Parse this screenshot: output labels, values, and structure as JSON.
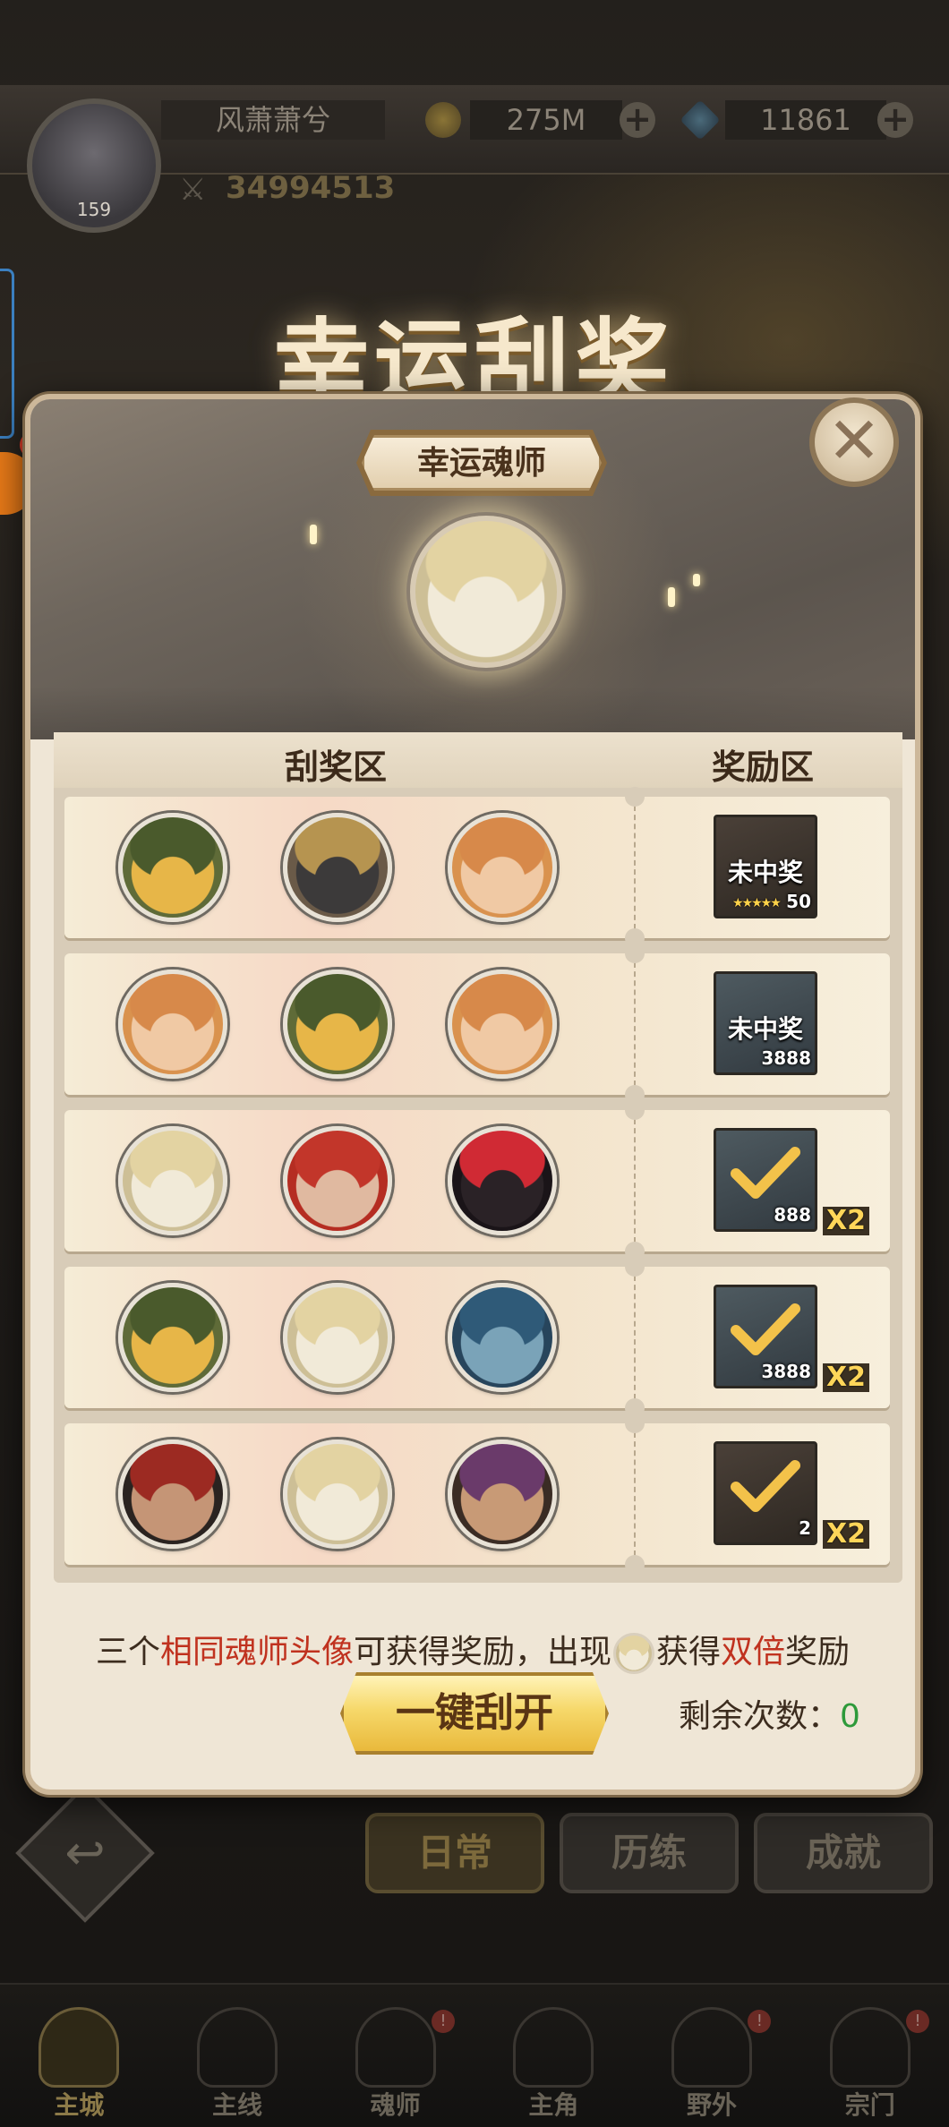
{
  "player": {
    "name": "风萧萧兮",
    "level": "159",
    "gold": "275M",
    "diamonds": "11861",
    "power": "34994513"
  },
  "background": {
    "title": "幸运刮奖",
    "tabs": [
      "日常",
      "历练",
      "成就"
    ],
    "active_tab": "日常",
    "nav": [
      {
        "label": "主城",
        "active": true,
        "badge": ""
      },
      {
        "label": "主线",
        "active": false,
        "badge": ""
      },
      {
        "label": "魂师",
        "active": false,
        "badge": "!"
      },
      {
        "label": "主角",
        "active": false,
        "badge": ""
      },
      {
        "label": "野外",
        "active": false,
        "badge": "!"
      },
      {
        "label": "宗门",
        "active": false,
        "badge": "!"
      }
    ]
  },
  "modal": {
    "section_title": "幸运魂师",
    "lucky_character": "blonde-soul-master",
    "header_scratch": "刮奖区",
    "header_reward": "奖励区",
    "rows": [
      {
        "avatars": [
          "green-hood-girl",
          "blonde-bearded-man",
          "ginger-girl"
        ],
        "reward": {
          "type": "card",
          "name": "未中奖",
          "count": "50",
          "stars": "★★★★★",
          "multiplier": ""
        }
      },
      {
        "avatars": [
          "ginger-girl",
          "green-hood-girl",
          "ginger-girl"
        ],
        "reward": {
          "type": "gem",
          "name": "未中奖",
          "count": "3888",
          "stars": "",
          "multiplier": ""
        }
      },
      {
        "avatars": [
          "blonde-soul-master",
          "red-hair-man",
          "black-hair-flower-woman"
        ],
        "reward": {
          "type": "gem",
          "name": "",
          "count": "888",
          "stars": "",
          "multiplier": "X2"
        }
      },
      {
        "avatars": [
          "green-hood-girl",
          "blonde-soul-master",
          "blue-hair-man"
        ],
        "reward": {
          "type": "gem",
          "name": "",
          "count": "3888",
          "stars": "",
          "multiplier": "X2"
        }
      },
      {
        "avatars": [
          "dark-bearded-man",
          "blonde-soul-master",
          "monocle-man"
        ],
        "reward": {
          "type": "card",
          "name": "",
          "count": "2",
          "stars": "",
          "multiplier": "X2"
        }
      }
    ],
    "rule_prefix": "三个",
    "rule_hl1": "相同魂师头像",
    "rule_mid": "可获得奖励，出现",
    "rule_mid2": "获得",
    "rule_hl2": "双倍",
    "rule_suffix": "奖励",
    "button_label": "一键刮开",
    "remaining_label": "剩余次数：",
    "remaining_value": "0",
    "close_label": "✕"
  },
  "colors": {
    "highlight_red": "#c0321f",
    "remaining_green": "#2e9a3a",
    "button_gold": "#f6d86a"
  },
  "avatar_styles": {
    "green-hood-girl": {
      "bg": "#e7b648",
      "ring": "#5f6b38",
      "hair": "#4a5a2c"
    },
    "blonde-bearded-man": {
      "bg": "#3c3a3a",
      "ring": "#6a5a48",
      "hair": "#b69450"
    },
    "ginger-girl": {
      "bg": "#f0c9a4",
      "ring": "#d9924e",
      "hair": "#d7894a"
    },
    "blonde-soul-master": {
      "bg": "#f1ead8",
      "ring": "#cdbf96",
      "hair": "#e3d3a2"
    },
    "red-hair-man": {
      "bg": "#e0b9a0",
      "ring": "#b52d22",
      "hair": "#c2362a"
    },
    "black-hair-flower-woman": {
      "bg": "#2a2226",
      "ring": "#1a1418",
      "hair": "#d02a34"
    },
    "blue-hair-man": {
      "bg": "#7aa3b8",
      "ring": "#27455c",
      "hair": "#2f5a78"
    },
    "dark-bearded-man": {
      "bg": "#c59576",
      "ring": "#2a2320",
      "hair": "#9c2a22"
    },
    "monocle-man": {
      "bg": "#c89a76",
      "ring": "#3a2c24",
      "hair": "#6a3a6a"
    }
  }
}
